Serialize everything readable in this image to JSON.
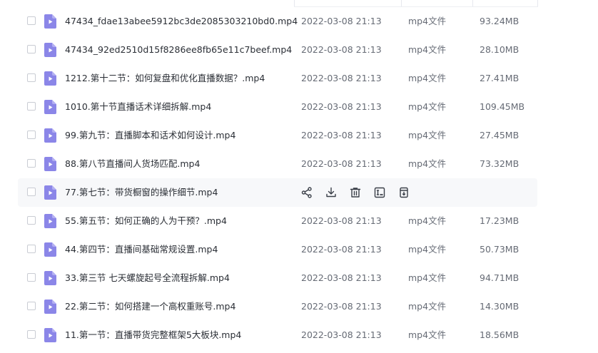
{
  "file_list": {
    "rows": [
      {
        "name": "47434_fdae13abee5912bc3de2085303210bd0.mp4",
        "date": "2022-03-08 21:13",
        "type": "mp4文件",
        "size": "93.24MB"
      },
      {
        "name": "47434_92ed2510d15f8286ee8fb65e11c7beef.mp4",
        "date": "2022-03-08 21:13",
        "type": "mp4文件",
        "size": "28.10MB"
      },
      {
        "name": "1212.第十二节：如何复盘和优化直播数据？.mp4",
        "date": "2022-03-08 21:13",
        "type": "mp4文件",
        "size": "27.41MB"
      },
      {
        "name": "1010.第十节直播话术详细拆解.mp4",
        "date": "2022-03-08 21:13",
        "type": "mp4文件",
        "size": "109.45MB"
      },
      {
        "name": "99.第九节：直播脚本和话术如何设计.mp4",
        "date": "2022-03-08 21:13",
        "type": "mp4文件",
        "size": "27.45MB"
      },
      {
        "name": "88.第八节直播间人货场匹配.mp4",
        "date": "2022-03-08 21:13",
        "type": "mp4文件",
        "size": "73.32MB"
      },
      {
        "name": "77.第七节：带货橱窗的操作细节.mp4",
        "date": "",
        "type": "",
        "size": ""
      },
      {
        "name": "55.第五节：如何正确的人为干预？.mp4",
        "date": "2022-03-08 21:13",
        "type": "mp4文件",
        "size": "17.23MB"
      },
      {
        "name": "44.第四节：直播间基础常规设置.mp4",
        "date": "2022-03-08 21:13",
        "type": "mp4文件",
        "size": "50.73MB"
      },
      {
        "name": "33.第三节 七天螺旋起号全流程拆解.mp4",
        "date": "2022-03-08 21:13",
        "type": "mp4文件",
        "size": "94.71MB"
      },
      {
        "name": "22.第二节：如何搭建一个高权重账号.mp4",
        "date": "2022-03-08 21:13",
        "type": "mp4文件",
        "size": "14.30MB"
      },
      {
        "name": "11.第一节：直播带货完整框架5大板块.mp4",
        "date": "2022-03-08 21:13",
        "type": "mp4文件",
        "size": "18.56MB"
      }
    ],
    "hovered_actions": [
      "share-icon",
      "download-icon",
      "delete-icon",
      "rename-icon",
      "more-file-icon"
    ]
  },
  "colors": {
    "file_icon": "#8b86e8",
    "text_primary": "#2b2f36",
    "text_secondary": "#666b75",
    "hover_bg": "#f7f8fa"
  }
}
